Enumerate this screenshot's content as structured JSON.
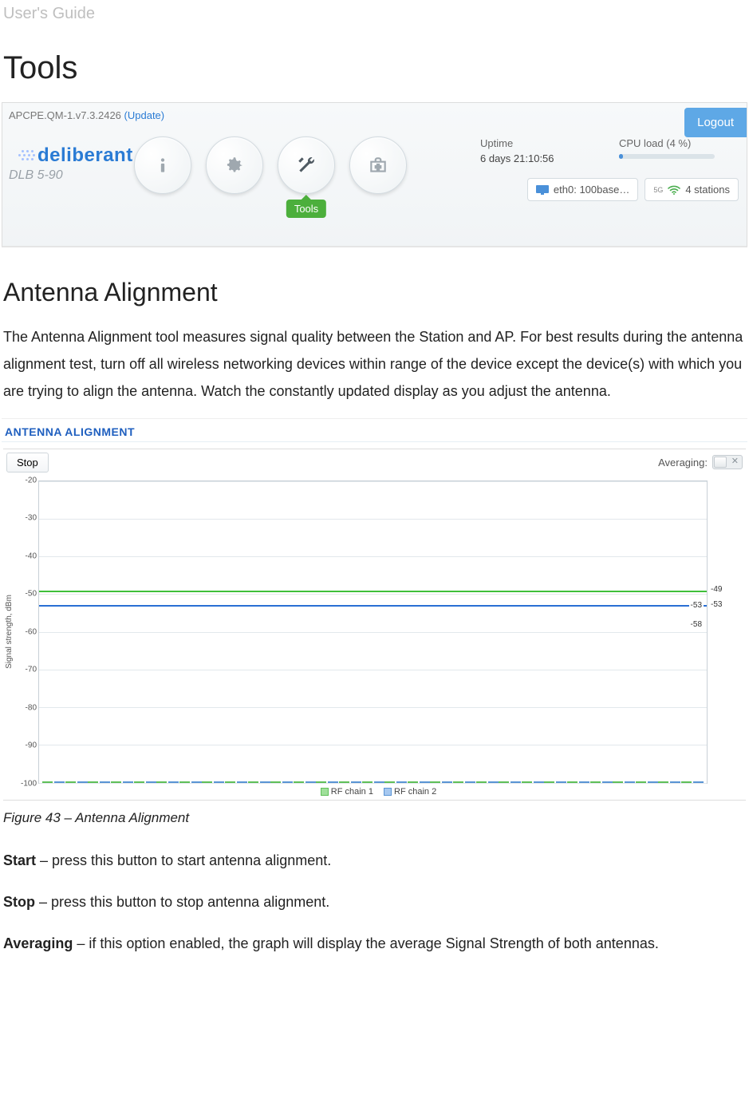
{
  "doc": {
    "header": "User's Guide",
    "h1": "Tools",
    "h2": "Antenna Alignment",
    "intro": "The Antenna Alignment tool measures signal quality between the Station and AP. For best results during the antenna alignment test, turn off all wireless networking devices within range of the device except the device(s) with which you are trying to align the antenna. Watch the constantly updated display as you adjust the antenna.",
    "fig_caption": "Figure 43 – Antenna Alignment",
    "defs": {
      "start_term": "Start",
      "start_rest": " – press this button to start antenna alignment.",
      "stop_term": "Stop",
      "stop_rest": " – press this button to stop antenna alignment.",
      "avg_term": "Averaging",
      "avg_rest": " – if this option enabled, the graph will display the average Signal Strength of both antennas."
    }
  },
  "device_bar": {
    "firmware": "APCPE.QM-1.v7.3.2426",
    "update_link": "(Update)",
    "logout": "Logout",
    "brand": "deliberant",
    "model": "DLB 5-90",
    "active_tool_label": "Tools",
    "uptime_label": "Uptime",
    "uptime_value": "6 days 21:10:56",
    "cpu_label": "CPU load (4 %)",
    "cpu_percent": 4,
    "badge_eth_label": "eth0: 100base…",
    "badge_wifi_prefix": "5G",
    "badge_wifi_label": "4 stations"
  },
  "alignment_panel": {
    "title": "ANTENNA ALIGNMENT",
    "stop_button": "Stop",
    "averaging_label": "Averaging:",
    "legend_chain1": "RF chain 1",
    "legend_chain2": "RF chain 2",
    "ylabel": "Signal strength, dBm",
    "right_marker_top": "-49",
    "right_marker_mid": "-53",
    "right_label_g": "-53",
    "right_label_b": "-58"
  },
  "chart_data": {
    "type": "bar",
    "title": "ANTENNA ALIGNMENT",
    "ylabel": "Signal strength, dBm",
    "ylim": [
      -100,
      -20
    ],
    "yticks": [
      -20,
      -30,
      -40,
      -50,
      -60,
      -70,
      -80,
      -90,
      -100
    ],
    "reference_lines": {
      "rf_chain_1": -49,
      "rf_chain_2": -53
    },
    "current_labels": {
      "rf_chain_1": -53,
      "rf_chain_2": -58
    },
    "series": [
      {
        "name": "RF chain 1",
        "color": "#9fdf9a",
        "values": [
          -51,
          -52,
          -50,
          -52,
          -50,
          -52,
          -51,
          -52,
          -50,
          -52,
          -50,
          -52,
          -52,
          -51,
          -51,
          -50,
          -52,
          -50,
          -52,
          -50,
          -52,
          -50,
          -52,
          -51,
          -52,
          -50,
          -51,
          -52,
          -53
        ]
      },
      {
        "name": "RF chain 2",
        "color": "#a6c8f0",
        "values": [
          -54,
          -55,
          -54,
          -55,
          -54,
          -55,
          -54,
          -55,
          -54,
          -55,
          -55,
          -54,
          -55,
          -54,
          -55,
          -54,
          -55,
          -54,
          -55,
          -54,
          -55,
          -54,
          -55,
          -55,
          -54,
          -55,
          -54,
          -55,
          -58
        ]
      }
    ],
    "n_samples": 29
  }
}
